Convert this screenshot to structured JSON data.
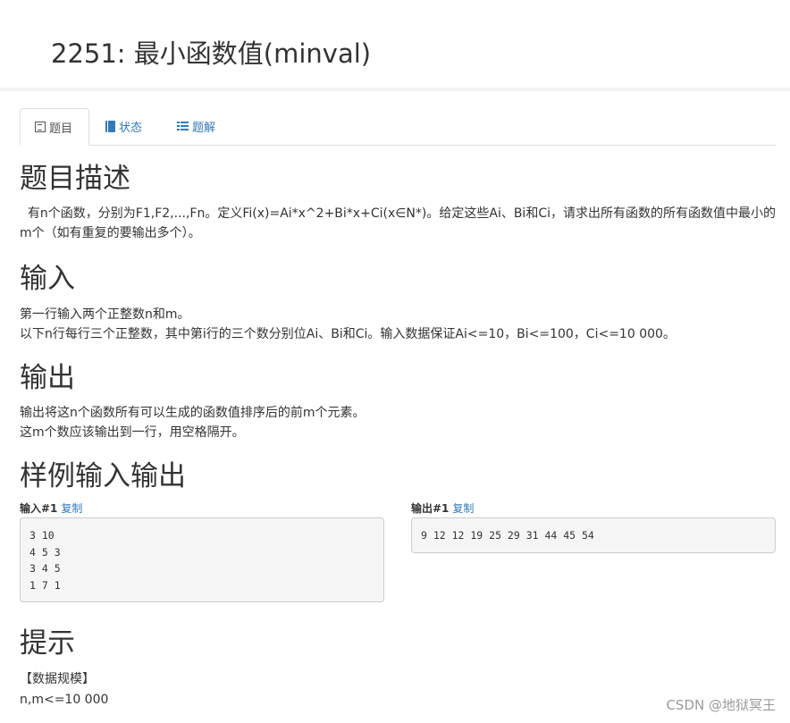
{
  "problem": {
    "title": "2251: 最小函数值(minval)"
  },
  "tabs": [
    {
      "label": "题目",
      "icon": "list-alt-icon",
      "active": true
    },
    {
      "label": "状态",
      "icon": "book-icon",
      "active": false
    },
    {
      "label": "题解",
      "icon": "list-icon",
      "active": false
    }
  ],
  "sections": {
    "description": {
      "heading": "题目描述",
      "text": "  有n个函数，分别为F1,F2,...,Fn。定义Fi(x)=Ai*x^2+Bi*x+Ci(x∈N*)。给定这些Ai、Bi和Ci，请求出所有函数的所有函数值中最小的m个（如有重复的要输出多个）。"
    },
    "input": {
      "heading": "输入",
      "line1": "第一行输入两个正整数n和m。",
      "line2": "以下n行每行三个正整数，其中第i行的三个数分别位Ai、Bi和Ci。输入数据保证Ai<=10，Bi<=100，Ci<=10 000。"
    },
    "output": {
      "heading": "输出",
      "line1": "输出将这n个函数所有可以生成的函数值排序后的前m个元素。",
      "line2": "这m个数应该输出到一行，用空格隔开。"
    },
    "samples": {
      "heading": "样例输入输出",
      "input_label": "输入#1",
      "output_label": "输出#1",
      "copy_label": "复制",
      "input_text": "3 10\n4 5 3\n3 4 5\n1 7 1",
      "output_text": "9 12 12 19 25 29 31 44 45 54"
    },
    "hint": {
      "heading": "提示",
      "line1": "【数据规模】",
      "line2": "n,m<=10 000"
    }
  },
  "watermark": "CSDN @地狱冥王",
  "colors": {
    "link": "#337ab7",
    "text": "#333333",
    "code_bg": "#f5f5f5",
    "border": "#dddddd"
  }
}
